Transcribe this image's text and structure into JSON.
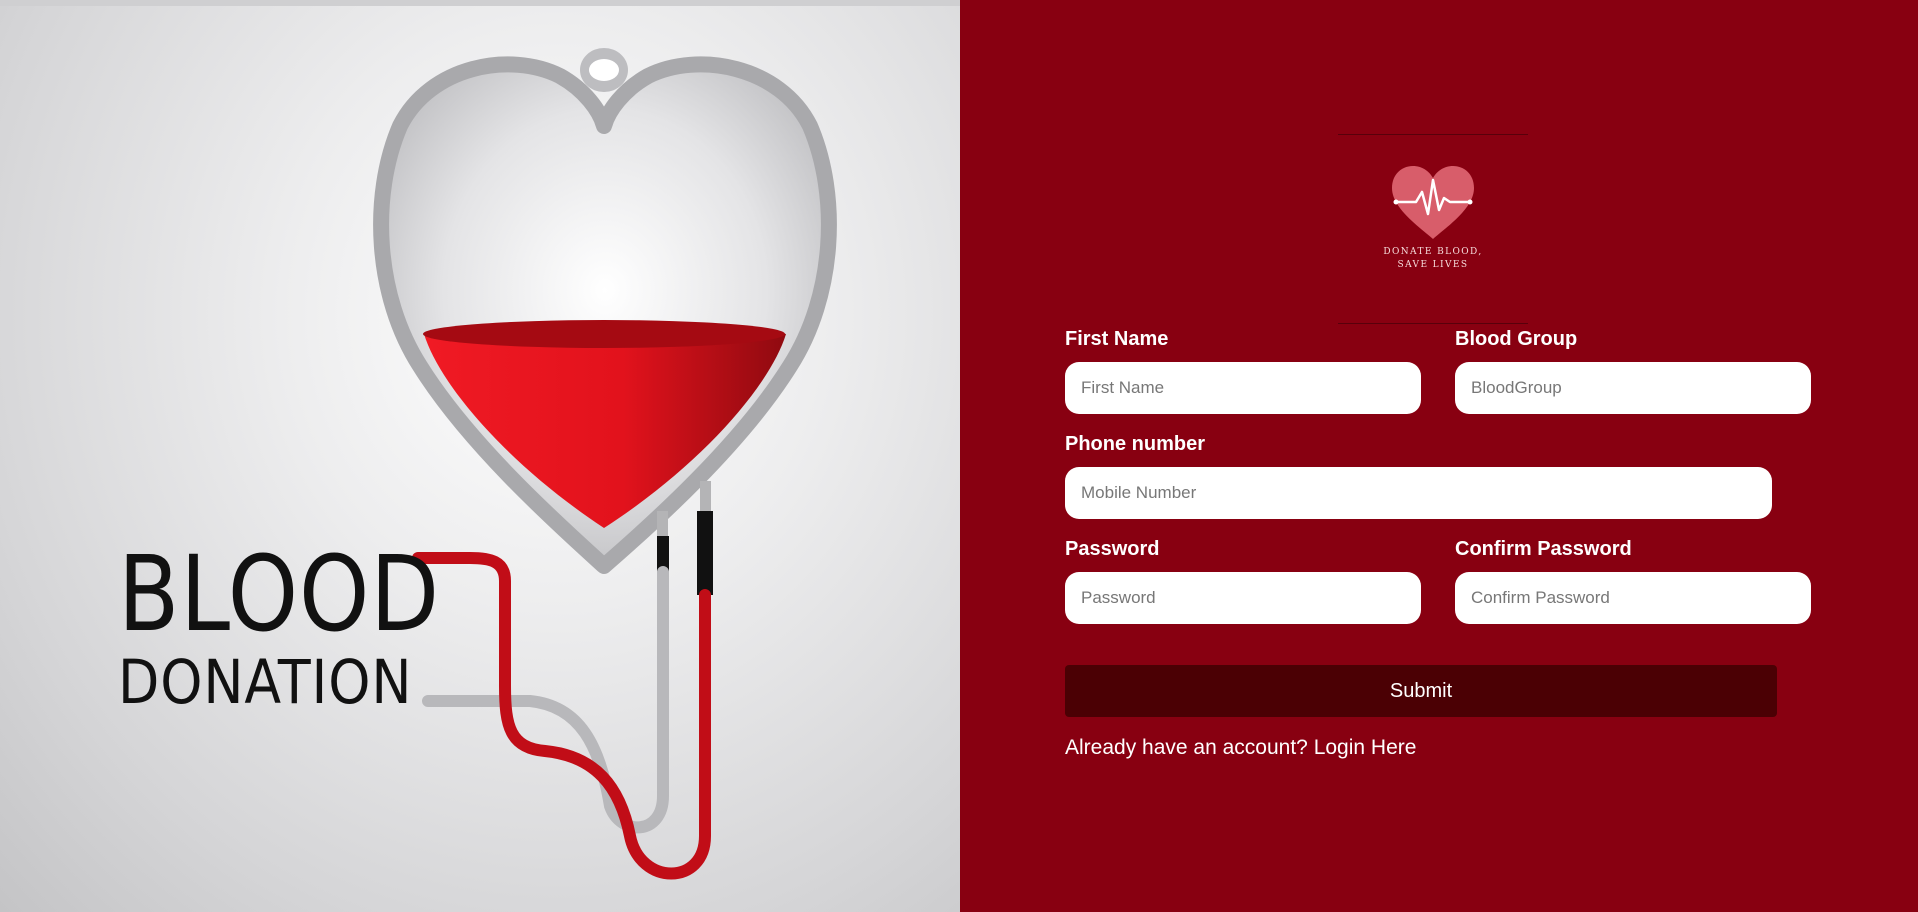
{
  "hero": {
    "brand_line1": "BLOOD",
    "brand_line2": "DONATION"
  },
  "logo": {
    "caption_line1": "Donate blood,",
    "caption_line2": "save lives"
  },
  "form": {
    "first_name": {
      "label": "First Name",
      "placeholder": "First Name",
      "value": ""
    },
    "blood_group": {
      "label": "Blood Group",
      "placeholder": "BloodGroup",
      "value": ""
    },
    "phone": {
      "label": "Phone number",
      "placeholder": "Mobile Number",
      "value": ""
    },
    "password": {
      "label": "Password",
      "placeholder": "Password",
      "value": ""
    },
    "confirm_password": {
      "label": "Confirm Password",
      "placeholder": "Confirm Password",
      "value": ""
    },
    "submit_label": "Submit",
    "login_prompt": "Already have an account?",
    "login_link": "Login Here"
  },
  "colors": {
    "panel_bg": "#880011",
    "submit_bg": "#4b0004",
    "blood_red": "#e8141f"
  }
}
